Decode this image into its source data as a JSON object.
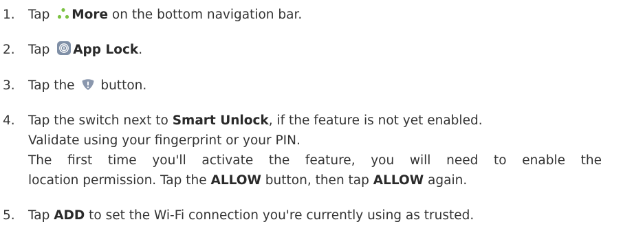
{
  "steps": [
    {
      "number": "1.",
      "pre": "Tap",
      "icon": "more-icon",
      "bold": "More",
      "post": "on the bottom navigation bar."
    },
    {
      "number": "2.",
      "pre": "Tap",
      "icon": "app-lock-icon",
      "bold": "App Lock",
      "post": "."
    },
    {
      "number": "3.",
      "pre": "Tap the",
      "icon": "shield-alert-icon",
      "post": "button."
    },
    {
      "number": "4.",
      "line1_pre": "Tap the switch next to",
      "line1_bold": "Smart Unlock",
      "line1_post": ", if the feature is not yet enabled.",
      "line2": "Validate using your fingerprint or your PIN.",
      "line3": "The first time you'll activate the feature, you will need to enable the",
      "line4_pre": "location permission. Tap the",
      "line4_bold1": "ALLOW",
      "line4_mid": "button, then tap",
      "line4_bold2": "ALLOW",
      "line4_post": "again."
    },
    {
      "number": "5.",
      "pre": "Tap",
      "bold": "ADD",
      "post": "to set the Wi-Fi connection you're currently using as trusted."
    }
  ],
  "colors": {
    "text": "#333333",
    "icon_more": "#7cc243",
    "icon_app_lock": "#7f8fa6",
    "icon_shield": "#8a97ad"
  }
}
